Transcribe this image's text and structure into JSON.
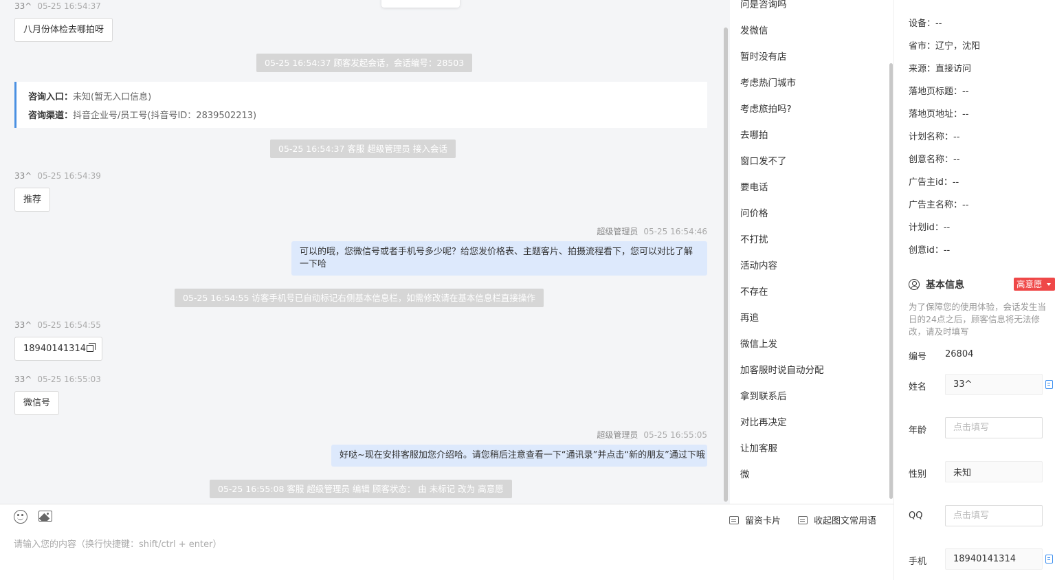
{
  "chat": {
    "messages": [
      {
        "kind": "visitor",
        "sender": "33^",
        "time": "05-25 16:54:37",
        "text": "八月份体检去哪拍呀"
      },
      {
        "kind": "system",
        "text": "05-25 16:54:37 顾客发起会话，会话编号：28503"
      },
      {
        "kind": "info",
        "entry_label": "咨询入口：",
        "entry_value": "未知(暂无入口信息)",
        "channel_label": "咨询渠道：",
        "channel_value": "抖音企业号/员工号(抖音号ID：2839502213)"
      },
      {
        "kind": "system",
        "text": "05-25 16:54:37 客服 超级管理员 接入会话"
      },
      {
        "kind": "visitor",
        "sender": "33^",
        "time": "05-25 16:54:39",
        "text": "推荐"
      },
      {
        "kind": "agent",
        "sender": "超级管理员",
        "time": "05-25 16:54:46",
        "text": "可以的哦，您微信号或者手机号多少呢？给您发价格表、主题客片、拍摄流程看下，您可以对比了解一下哈"
      },
      {
        "kind": "system",
        "text": "05-25 16:54:55 访客手机号已自动标记右侧基本信息栏，如需修改请在基本信息栏直接操作"
      },
      {
        "kind": "visitor",
        "sender": "33^",
        "time": "05-25 16:54:55",
        "text": "18940141314"
      },
      {
        "kind": "visitor",
        "sender": "33^",
        "time": "05-25 16:55:03",
        "text": "微信号"
      },
      {
        "kind": "agent",
        "sender": "超级管理员",
        "time": "05-25 16:55:05",
        "text": "好哒~现在安排客服加您介绍哈。请您稍后注意查看一下“通讯录”并点击“新的朋友”通过下哦"
      },
      {
        "kind": "system",
        "text": "05-25 16:55:08 客服 超级管理员 编辑 顾客状态： 由 未标记 改为 高意愿"
      }
    ]
  },
  "phrases": [
    "问是咨询吗",
    "发微信",
    "暂时没有店",
    "考虑热门城市",
    "考虑旅拍吗?",
    "去哪拍",
    "窗口发不了",
    "要电话",
    "问价格",
    "不打扰",
    "活动内容",
    "不存在",
    "再追",
    "微信上发",
    "加客服时说自动分配",
    "拿到联系后",
    "对比再决定",
    "让加客服",
    "微"
  ],
  "input": {
    "placeholder": "请输入您的内容（换行快捷键：shift/ctrl + enter）",
    "card_button": "留资卡片",
    "collapse_button": "收起图文常用语"
  },
  "visitor_info": [
    "设备：--",
    "省市：辽宁，沈阳",
    "来源：直接访问",
    "落地页标题：--",
    "落地页地址：--",
    "计划名称：--",
    "创意名称：--",
    "广告主id：--",
    "广告主名称：--",
    "计划id：--",
    "创意id：--"
  ],
  "basic_info": {
    "title": "基本信息",
    "status": "高意愿",
    "notice": "为了保障您的使用体验，会话发生当日的24点之后，顾客信息将无法修改，请及时填写",
    "id_label": "编号",
    "id_value": "26804",
    "name_label": "姓名",
    "name_value": "33^",
    "age_label": "年龄",
    "age_placeholder": "点击填写",
    "gender_label": "性别",
    "gender_value": "未知",
    "qq_label": "QQ",
    "qq_placeholder": "点击填写",
    "phone_label": "手机",
    "phone_value": "18940141314"
  },
  "colors": {
    "accent": "#4a90e2",
    "agent_bubble": "#dde9fc",
    "status_badge": "#ef4848",
    "system_msg": "#d6d6d6"
  }
}
